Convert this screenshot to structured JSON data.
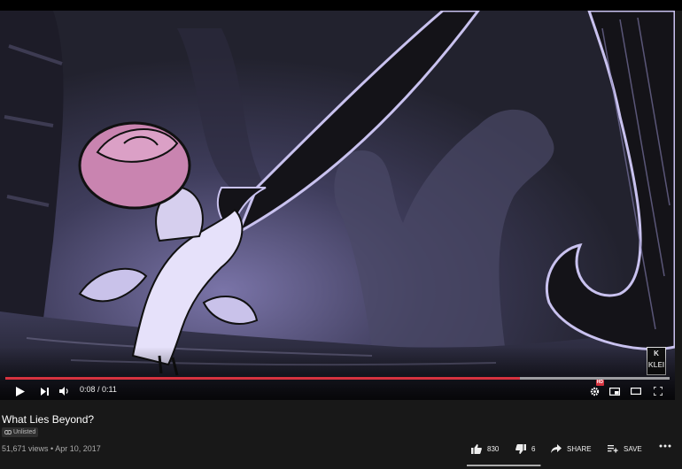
{
  "video": {
    "current_time": "0:08",
    "separator": " / ",
    "duration": "0:11",
    "progress_played_fraction": 0.775,
    "progress_loaded_fraction": 1.0,
    "watermark": "K\nKLEI",
    "hd_badge": "HD"
  },
  "info": {
    "title": "What Lies Beyond?",
    "visibility": "Unlisted",
    "views": "51,671 views",
    "dot": " • ",
    "date": "Apr 10, 2017"
  },
  "actions": {
    "likes": "830",
    "dislikes": "6",
    "share": "SHARE",
    "save": "SAVE",
    "like_ratio": 0.99
  },
  "colors": {
    "background": "#181818",
    "progress": "#d6323f"
  }
}
